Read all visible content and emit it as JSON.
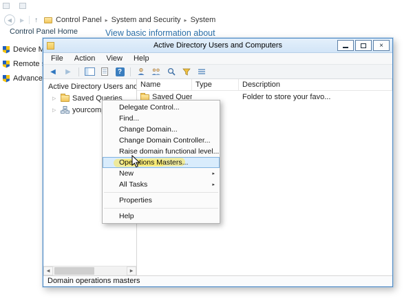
{
  "colors": {
    "window_border": "#4a86c2",
    "titlebar": "#dceafa",
    "menu_highlight": "#d9ecfc",
    "annotation_yellow": "#ffe94d",
    "heading_blue": "#2b6fa8",
    "toolbar_arrow_blue": "#2f77c0"
  },
  "icons": {
    "back": "◀",
    "forward": "▶",
    "up": "↑",
    "crumb_sep": "▸",
    "expander": "▷",
    "submenu_arrow": "▸",
    "close": "×",
    "help": "?",
    "scroll_left": "◀",
    "scroll_right": "▶"
  },
  "background": {
    "top_nav": {
      "breadcrumb": [
        "Control Panel",
        "System and Security",
        "System"
      ]
    },
    "sidebar": {
      "home": "Control Panel Home",
      "items": [
        {
          "label": "Device Manager"
        },
        {
          "label": "Remote settings"
        },
        {
          "label": "Advanced system settings"
        }
      ]
    },
    "heading": "View basic information about"
  },
  "window": {
    "title": "Active Directory Users and Computers",
    "menubar": [
      "File",
      "Action",
      "View",
      "Help"
    ],
    "tree": {
      "root": "Active Directory Users and Computers",
      "children": [
        "Saved Queries",
        "yourcompu..."
      ]
    },
    "list": {
      "columns": [
        "Name",
        "Type",
        "Description"
      ],
      "rows": [
        {
          "name": "Saved Queries",
          "type": "",
          "description": "Folder to store your favo..."
        }
      ]
    },
    "context_menu": {
      "items": [
        "Delegate Control...",
        "Find...",
        "Change Domain...",
        "Change Domain Controller...",
        "Raise domain functional level...",
        "Operations Masters...",
        "New",
        "All Tasks",
        "Properties",
        "Help"
      ]
    },
    "status": "Domain operations masters"
  }
}
